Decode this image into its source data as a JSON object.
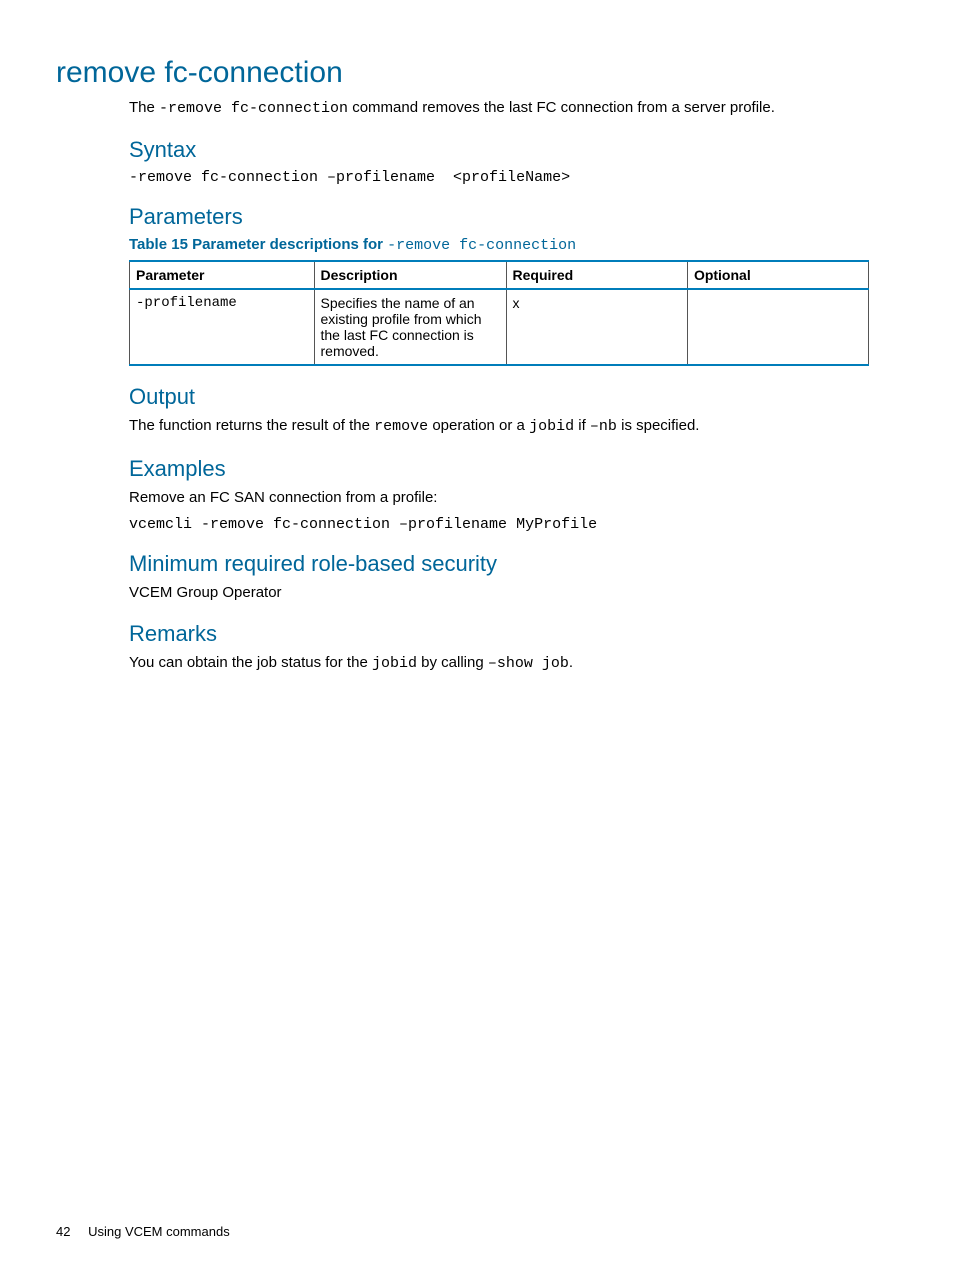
{
  "title": "remove fc-connection",
  "intro": {
    "pre": "The ",
    "code": "-remove fc-connection",
    "post": " command removes the last FC connection from a server profile."
  },
  "syntax": {
    "heading": "Syntax",
    "code": "-remove fc-connection –profilename  <profileName>"
  },
  "parameters": {
    "heading": "Parameters",
    "caption_prefix": "Table 15 Parameter descriptions for ",
    "caption_code": "-remove fc-connection",
    "headers": {
      "parameter": "Parameter",
      "description": "Description",
      "required": "Required",
      "optional": "Optional"
    },
    "rows": [
      {
        "parameter": "-profilename",
        "description": "Specifies the name of an existing profile from which the last FC connection is removed.",
        "required": "x",
        "optional": ""
      }
    ]
  },
  "output": {
    "heading": "Output",
    "text_1": "The function returns the result of the ",
    "code_1": "remove",
    "text_2": " operation or a ",
    "code_2": "jobid",
    "text_3": " if ",
    "code_3": "–nb",
    "text_4": " is specified."
  },
  "examples": {
    "heading": "Examples",
    "lead": "Remove an FC SAN connection from a profile:",
    "code": "vcemcli -remove fc-connection –profilename MyProfile"
  },
  "security": {
    "heading": "Minimum required role-based security",
    "text": "VCEM Group Operator"
  },
  "remarks": {
    "heading": "Remarks",
    "text_1": "You can obtain the job status for the ",
    "code_1": "jobid",
    "text_2": " by calling ",
    "code_2": "–show job",
    "text_3": "."
  },
  "footer": {
    "page": "42",
    "chapter": "Using VCEM commands"
  }
}
